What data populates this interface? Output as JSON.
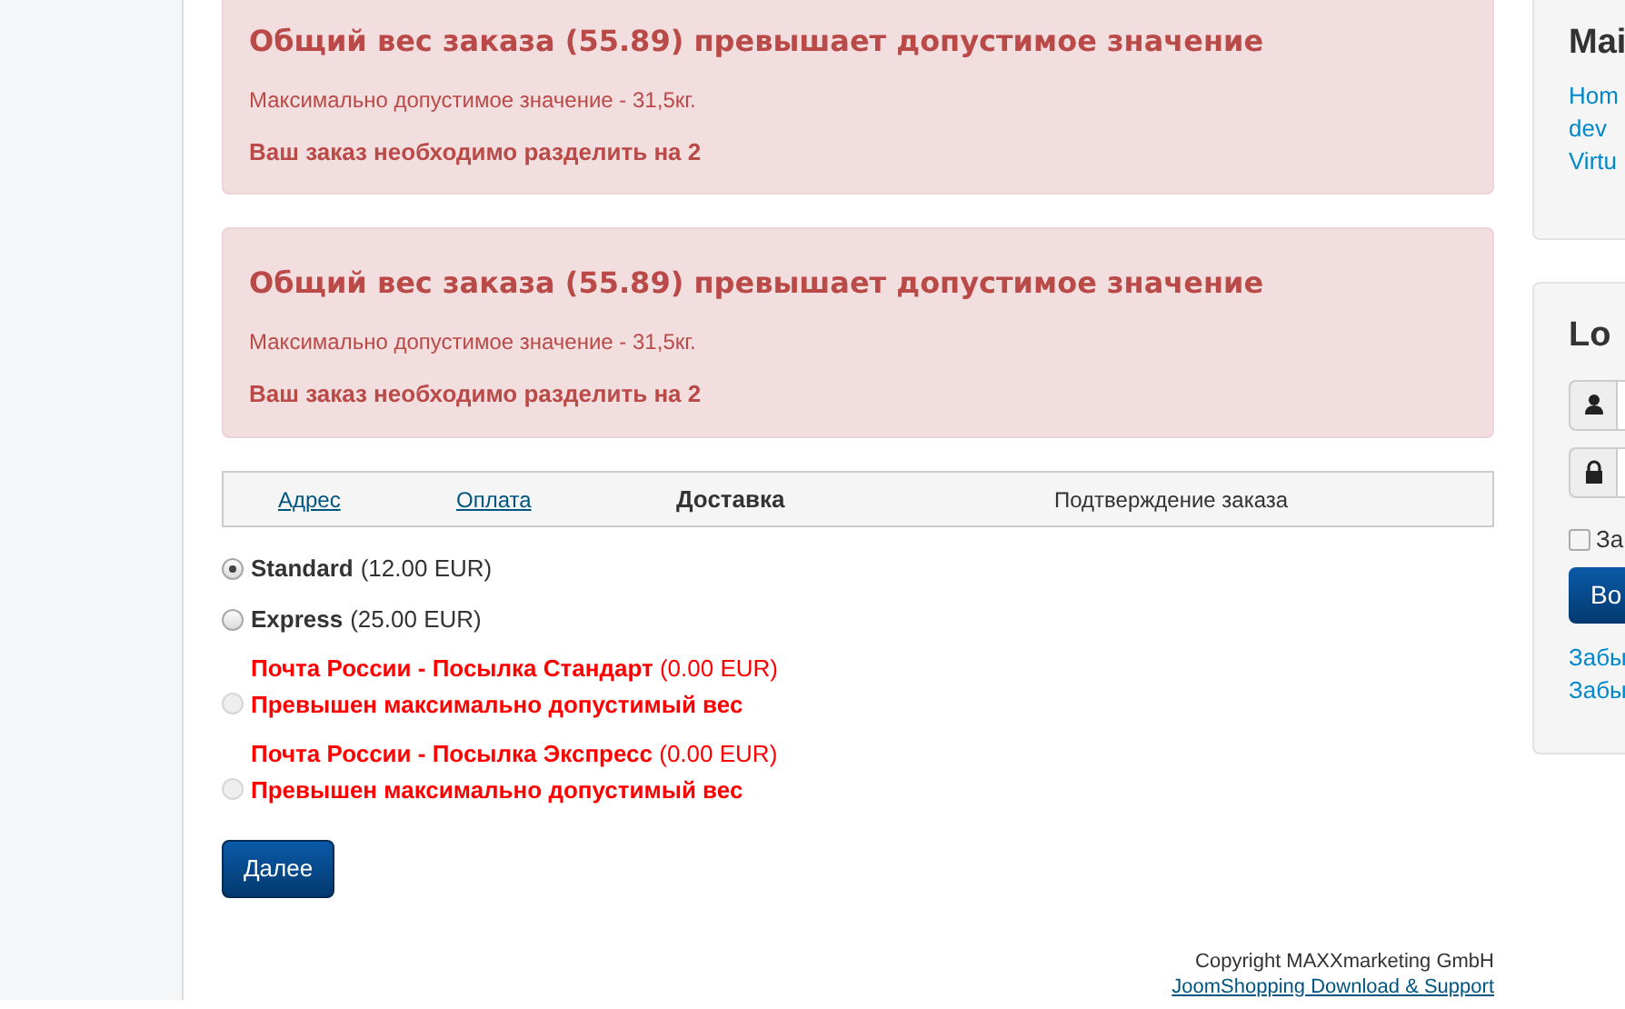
{
  "alerts": [
    {
      "title": "Общий вес заказа (55.89) превышает допустимое значение",
      "detail": "Максимально допустимое значение - 31,5кг.",
      "note": "Ваш заказ необходимо разделить на 2"
    },
    {
      "title": "Общий вес заказа (55.89) превышает допустимое значение",
      "detail": "Максимально допустимое значение - 31,5кг.",
      "note": "Ваш заказ необходимо разделить на 2"
    }
  ],
  "steps": [
    {
      "label": "Адрес",
      "kind": "link"
    },
    {
      "label": "Оплата",
      "kind": "link"
    },
    {
      "label": "Доставка",
      "kind": "current"
    },
    {
      "label": "Подтверждение заказа",
      "kind": "plain"
    }
  ],
  "shipping": [
    {
      "name": "Standard",
      "price": "(12.00 EUR)",
      "selected": true,
      "disabled": false
    },
    {
      "name": "Express",
      "price": "(25.00 EUR)",
      "selected": false,
      "disabled": false
    },
    {
      "name": "Почта России - Посылка Стандарт",
      "price": "(0.00 EUR)",
      "selected": false,
      "disabled": true,
      "error": "Превышен максимально допустимый вес"
    },
    {
      "name": "Почта России - Посылка Экспресс",
      "price": "(0.00 EUR)",
      "selected": false,
      "disabled": true,
      "error": "Превышен максимально допустимый вес"
    }
  ],
  "next_button": "Далее",
  "footer": [
    "Copyright MAXXmarketing GmbH",
    "JoomShopping Download & Support"
  ],
  "sidebar": {
    "menu": {
      "title": "Mai",
      "links": [
        "Hom",
        "dev",
        "Virtu"
      ]
    },
    "login": {
      "title": "Lo",
      "remember": {
        "label": "За",
        "checked": false
      },
      "button": "Во",
      "links": [
        "Забы",
        "Забы"
      ]
    }
  }
}
